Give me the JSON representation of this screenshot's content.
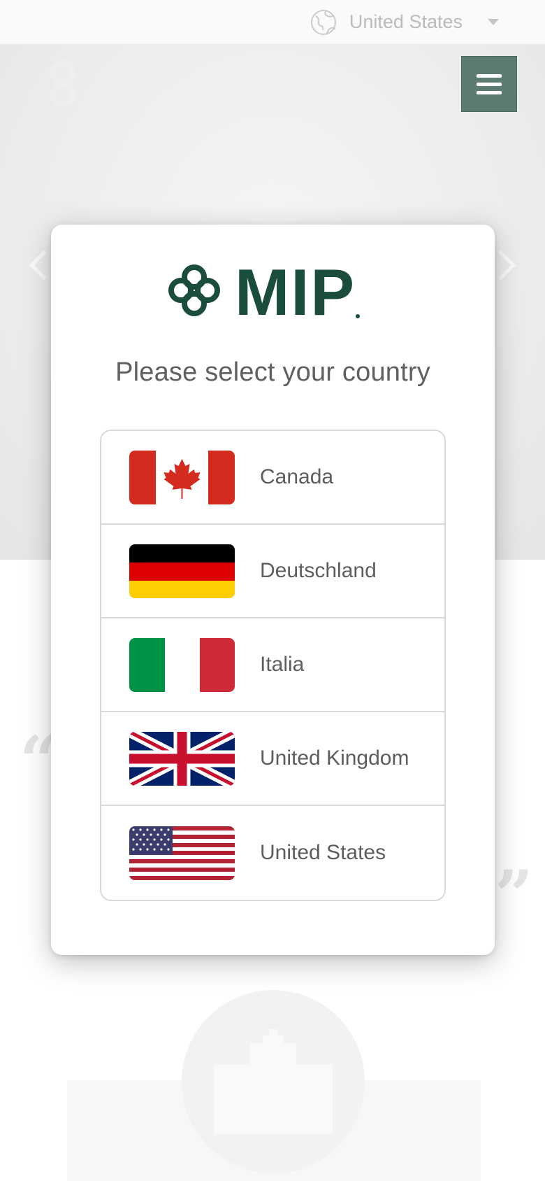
{
  "topbar": {
    "country_label": "United States",
    "globe_icon": "globe-icon",
    "caret_icon": "chevron-down-icon"
  },
  "hero": {
    "menu_icon": "hamburger-menu-icon",
    "prev_icon": "chevron-left-icon",
    "next_icon": "chevron-right-icon",
    "menu_color": "#1e4a3c"
  },
  "modal": {
    "brand": "MIP",
    "brand_color": "#1a4d3e",
    "title": "Please select your country",
    "countries": [
      {
        "label": "Canada",
        "flag_icon": "canada-flag-icon"
      },
      {
        "label": "Deutschland",
        "flag_icon": "germany-flag-icon"
      },
      {
        "label": "Italia",
        "flag_icon": "italy-flag-icon"
      },
      {
        "label": "United Kingdom",
        "flag_icon": "uk-flag-icon"
      },
      {
        "label": "United States",
        "flag_icon": "usa-flag-icon"
      }
    ]
  },
  "background": {
    "quote_open": "“",
    "quote_close": "”",
    "feature_icon": "hospital-icon"
  }
}
